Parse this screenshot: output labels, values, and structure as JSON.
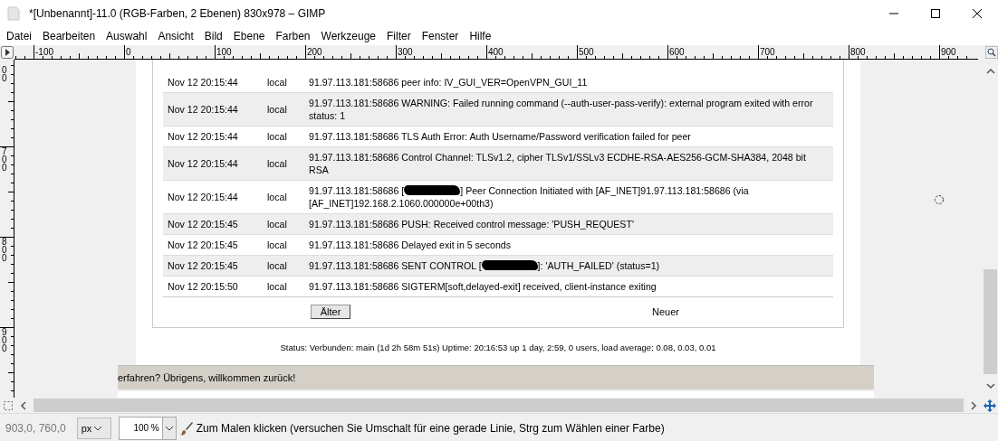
{
  "window": {
    "title": "*[Unbenannt]-11.0 (RGB-Farben, 2 Ebenen) 830x978 – GIMP"
  },
  "menu": [
    "Datei",
    "Bearbeiten",
    "Auswahl",
    "Ansicht",
    "Bild",
    "Ebene",
    "Farben",
    "Werkzeuge",
    "Filter",
    "Fenster",
    "Hilfe"
  ],
  "rulers": {
    "horizontal": [
      "-100",
      "0",
      "100",
      "200",
      "300",
      "400",
      "500",
      "600",
      "700",
      "800",
      "900"
    ],
    "vertical": [
      "00",
      "700",
      "800",
      "900"
    ]
  },
  "log": {
    "rows": [
      {
        "date": "Nov 12 20:15:44",
        "source": "local",
        "message": [
          {
            "kind": "text",
            "text": "91.97.113.181:58686 peer info: IV_GUI_VER=OpenVPN_GUI_11"
          }
        ]
      },
      {
        "date": "Nov 12 20:15:44",
        "source": "local",
        "message": [
          {
            "kind": "text",
            "text": "91.97.113.181:58686 WARNING: Failed running command (--auth-user-pass-verify): external program exited with error status: 1"
          }
        ]
      },
      {
        "date": "Nov 12 20:15:44",
        "source": "local",
        "message": [
          {
            "kind": "text",
            "text": "91.97.113.181:58686 TLS Auth Error: Auth Username/Password verification failed for peer"
          }
        ]
      },
      {
        "date": "Nov 12 20:15:44",
        "source": "local",
        "message": [
          {
            "kind": "text",
            "text": "91.97.113.181:58686 Control Channel: TLSv1.2, cipher TLSv1/SSLv3 ECDHE-RSA-AES256-GCM-SHA384, 2048 bit RSA"
          }
        ]
      },
      {
        "date": "Nov 12 20:15:44",
        "source": "local",
        "message": [
          {
            "kind": "text",
            "text": "91.97.113.181:58686 ["
          },
          {
            "kind": "redacted"
          },
          {
            "kind": "text",
            "text": "] Peer Connection Initiated with [AF_INET]91.97.113.181:58686 (via [AF_INET]192.168.2.1060.000000e+00th3)"
          }
        ]
      },
      {
        "date": "Nov 12 20:15:45",
        "source": "local",
        "message": [
          {
            "kind": "text",
            "text": "91.97.113.181:58686 PUSH: Received control message: 'PUSH_REQUEST'"
          }
        ]
      },
      {
        "date": "Nov 12 20:15:45",
        "source": "local",
        "message": [
          {
            "kind": "text",
            "text": "91.97.113.181:58686 Delayed exit in 5 seconds"
          }
        ]
      },
      {
        "date": "Nov 12 20:15:45",
        "source": "local",
        "message": [
          {
            "kind": "text",
            "text": "91.97.113.181:58686 SENT CONTROL ["
          },
          {
            "kind": "redacted"
          },
          {
            "kind": "text",
            "text": "]: 'AUTH_FAILED' (status=1)"
          }
        ]
      },
      {
        "date": "Nov 12 20:15:50",
        "source": "local",
        "message": [
          {
            "kind": "text",
            "text": "91.97.113.181:58686 SIGTERM[soft,delayed-exit] received, client-instance exiting"
          }
        ]
      }
    ],
    "pager": [
      {
        "kind": "button",
        "label": "Älter"
      },
      {
        "kind": "text",
        "label": "Neuer"
      }
    ],
    "status": "Status: Verbunden: main (1d 2h 58m 51s) Uptime: 20:16:53 up 1 day, 2:59, 0 users, load average: 0.08, 0.03, 0.01"
  },
  "banner": "erfahren? Übrigens, willkommen zurück!",
  "status_bar": {
    "coords": "903,0, 760,0",
    "unit": "px",
    "zoom": "100 %",
    "message": "Zum Malen klicken (versuchen Sie Umschalt für eine gerade Linie, Strg zum Wählen einer Farbe)"
  }
}
